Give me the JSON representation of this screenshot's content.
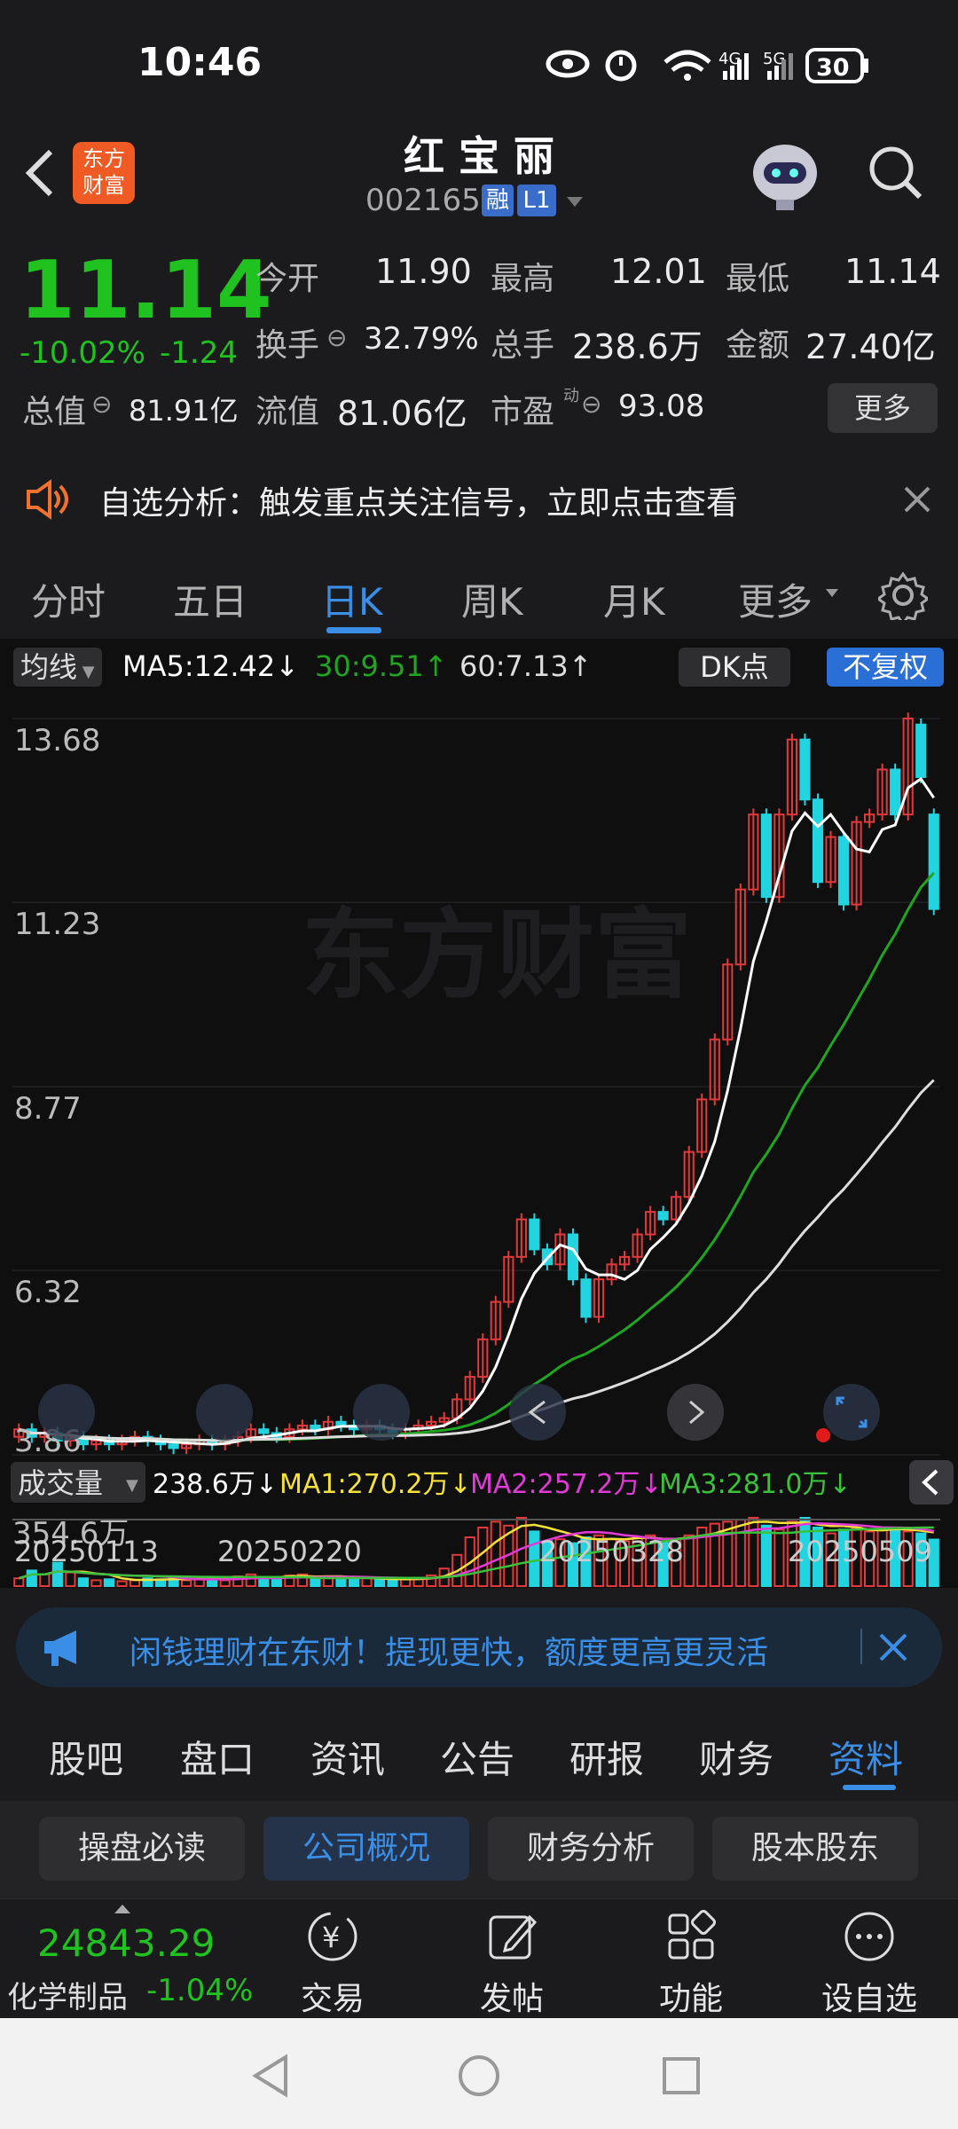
{
  "status": {
    "time": "10:46",
    "battery": "30",
    "net1": "4G",
    "net2": "5G"
  },
  "header": {
    "title": "红 宝 丽",
    "code": "002165",
    "badge1": "融",
    "badge2": "L1",
    "logo_line1": "东方",
    "logo_line2": "财富"
  },
  "quote": {
    "price": "11.14",
    "pct": "-10.02%",
    "chg": "-1.24",
    "open_label": "今开",
    "open": "11.90",
    "high_label": "最高",
    "high": "12.01",
    "low_label": "最低",
    "low": "11.14",
    "turnover_label": "换手",
    "turnover": "32.79%",
    "volume_label": "总手",
    "volume": "238.6万",
    "amount_label": "金额",
    "amount": "27.40亿",
    "mktcap_label": "总值",
    "mktcap": "81.91亿",
    "float_label": "流值",
    "float": "81.06亿",
    "pe_label": "市盈",
    "pe_sup": "动",
    "pe": "93.08",
    "more": "更多"
  },
  "alert": {
    "text": "自选分析：触发重点关注信号，立即点击查看"
  },
  "tabs": [
    "分时",
    "五日",
    "日K",
    "周K",
    "月K",
    "更多"
  ],
  "active_tab": "日K",
  "ma": {
    "label": "均线",
    "ma5": "MA5:12.42↓",
    "ma30": "30:9.51↑",
    "ma60": "60:7.13↑",
    "dk": "DK点",
    "fq": "不复权"
  },
  "price_axis": [
    "13.68",
    "11.23",
    "8.77",
    "6.32",
    "3.86"
  ],
  "vol": {
    "label": "成交量",
    "value": "238.6万↓",
    "ma1": "MA1:270.2万↓",
    "ma2": "MA2:257.2万↓",
    "ma3": "MA3:281.0万↓",
    "max": "354.6万"
  },
  "dates": [
    "20250113",
    "20250220",
    "20250328",
    "20250509"
  ],
  "watermark": "东方财富",
  "promo": {
    "text": "闲钱理财在东财！提现更快，额度更高更灵活"
  },
  "subtabs": [
    "股吧",
    "盘口",
    "资讯",
    "公告",
    "研报",
    "财务",
    "资料"
  ],
  "active_subtab": "资料",
  "chips": [
    "操盘必读",
    "公司概况",
    "财务分析",
    "股本股东"
  ],
  "active_chip": "公司概况",
  "bottom": {
    "index_value": "24843.29",
    "index_name": "化学制品",
    "index_pct": "-1.04%",
    "trade": "交易",
    "post": "发帖",
    "func": "功能",
    "watch": "设自选"
  },
  "colors": {
    "up": "#e23a3a",
    "down": "#1fc21f",
    "accent": "#3a8ee6",
    "ma5": "#ffffff",
    "ma30": "#1fa51f",
    "ma60": "#dddddd",
    "vol_ma1": "#f5e13a",
    "vol_ma2": "#e23ad6",
    "vol_ma3": "#39c23a"
  },
  "chart_data": {
    "type": "candlestick",
    "price_range": [
      3.86,
      13.68
    ],
    "candles": [
      {
        "o": 4.1,
        "c": 4.2
      },
      {
        "o": 4.2,
        "c": 4.1
      },
      {
        "o": 4.1,
        "c": 4.15
      },
      {
        "o": 4.15,
        "c": 4.05
      },
      {
        "o": 4.05,
        "c": 4.1
      },
      {
        "o": 4.1,
        "c": 4.0
      },
      {
        "o": 4.0,
        "c": 4.05
      },
      {
        "o": 4.05,
        "c": 4.0
      },
      {
        "o": 4.0,
        "c": 4.05
      },
      {
        "o": 4.05,
        "c": 4.1
      },
      {
        "o": 4.1,
        "c": 4.05
      },
      {
        "o": 4.05,
        "c": 4.0
      },
      {
        "o": 4.0,
        "c": 3.95
      },
      {
        "o": 3.95,
        "c": 4.0
      },
      {
        "o": 4.0,
        "c": 4.05
      },
      {
        "o": 4.05,
        "c": 4.0
      },
      {
        "o": 4.0,
        "c": 4.05
      },
      {
        "o": 4.05,
        "c": 4.1
      },
      {
        "o": 4.1,
        "c": 4.2
      },
      {
        "o": 4.2,
        "c": 4.15
      },
      {
        "o": 4.15,
        "c": 4.1
      },
      {
        "o": 4.1,
        "c": 4.2
      },
      {
        "o": 4.2,
        "c": 4.25
      },
      {
        "o": 4.25,
        "c": 4.2
      },
      {
        "o": 4.2,
        "c": 4.3
      },
      {
        "o": 4.3,
        "c": 4.25
      },
      {
        "o": 4.25,
        "c": 4.2
      },
      {
        "o": 4.2,
        "c": 4.25
      },
      {
        "o": 4.25,
        "c": 4.2
      },
      {
        "o": 4.2,
        "c": 4.15
      },
      {
        "o": 4.15,
        "c": 4.2
      },
      {
        "o": 4.2,
        "c": 4.25
      },
      {
        "o": 4.25,
        "c": 4.3
      },
      {
        "o": 4.3,
        "c": 4.35
      },
      {
        "o": 4.35,
        "c": 4.6
      },
      {
        "o": 4.6,
        "c": 4.9
      },
      {
        "o": 4.9,
        "c": 5.4
      },
      {
        "o": 5.4,
        "c": 5.9
      },
      {
        "o": 5.9,
        "c": 6.5
      },
      {
        "o": 6.5,
        "c": 7.0
      },
      {
        "o": 7.0,
        "c": 6.6
      },
      {
        "o": 6.6,
        "c": 6.4
      },
      {
        "o": 6.4,
        "c": 6.8
      },
      {
        "o": 6.8,
        "c": 6.2
      },
      {
        "o": 6.2,
        "c": 5.7
      },
      {
        "o": 5.7,
        "c": 6.2
      },
      {
        "o": 6.2,
        "c": 6.4
      },
      {
        "o": 6.4,
        "c": 6.5
      },
      {
        "o": 6.5,
        "c": 6.8
      },
      {
        "o": 6.8,
        "c": 7.1
      },
      {
        "o": 7.1,
        "c": 7.0
      },
      {
        "o": 7.0,
        "c": 7.3
      },
      {
        "o": 7.3,
        "c": 7.9
      },
      {
        "o": 7.9,
        "c": 8.6
      },
      {
        "o": 8.6,
        "c": 9.4
      },
      {
        "o": 9.4,
        "c": 10.4
      },
      {
        "o": 10.4,
        "c": 11.4
      },
      {
        "o": 11.4,
        "c": 12.4
      },
      {
        "o": 12.4,
        "c": 11.3
      },
      {
        "o": 11.3,
        "c": 12.4
      },
      {
        "o": 12.4,
        "c": 13.4
      },
      {
        "o": 13.4,
        "c": 12.6
      },
      {
        "o": 12.6,
        "c": 11.5
      },
      {
        "o": 11.5,
        "c": 12.1
      },
      {
        "o": 12.1,
        "c": 11.2
      },
      {
        "o": 11.2,
        "c": 12.3
      },
      {
        "o": 12.3,
        "c": 12.4
      },
      {
        "o": 12.4,
        "c": 13.0
      },
      {
        "o": 13.0,
        "c": 12.4
      },
      {
        "o": 12.4,
        "c": 13.68
      },
      {
        "o": 13.6,
        "c": 12.9
      },
      {
        "o": 12.4,
        "c": 11.14
      }
    ],
    "volumes": [
      40,
      80,
      60,
      120,
      70,
      40,
      30,
      35,
      25,
      30,
      40,
      35,
      45,
      30,
      35,
      40,
      30,
      50,
      60,
      45,
      40,
      55,
      60,
      45,
      50,
      40,
      35,
      40,
      35,
      30,
      35,
      40,
      55,
      90,
      160,
      250,
      300,
      330,
      310,
      350,
      280,
      230,
      240,
      220,
      250,
      260,
      240,
      230,
      250,
      260,
      230,
      240,
      260,
      300,
      320,
      330,
      340,
      350,
      310,
      290,
      330,
      350,
      300,
      270,
      290,
      300,
      280,
      290,
      300,
      280,
      270,
      238.6
    ],
    "volume_colors": "red=up, cyan=down"
  }
}
